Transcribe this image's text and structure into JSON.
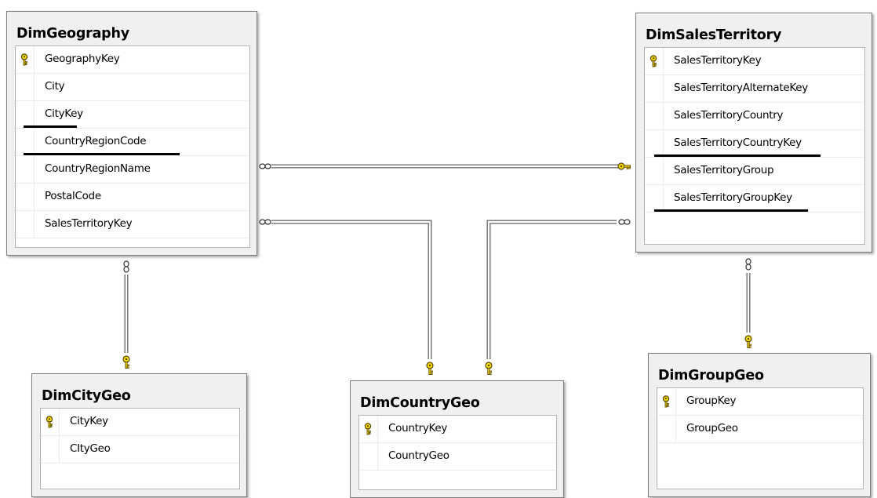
{
  "tables": {
    "dim_geography": {
      "title": "DimGeography",
      "columns": [
        {
          "name": "GeographyKey",
          "primary_key": true
        },
        {
          "name": "City",
          "primary_key": false
        },
        {
          "name": "CityKey",
          "primary_key": false,
          "underlined": true
        },
        {
          "name": "CountryRegionCode",
          "primary_key": false,
          "underlined": true
        },
        {
          "name": "CountryRegionName",
          "primary_key": false
        },
        {
          "name": "PostalCode",
          "primary_key": false
        },
        {
          "name": "SalesTerritoryKey",
          "primary_key": false
        }
      ]
    },
    "dim_sales_territory": {
      "title": "DimSalesTerritory",
      "columns": [
        {
          "name": "SalesTerritoryKey",
          "primary_key": true
        },
        {
          "name": "SalesTerritoryAlternateKey",
          "primary_key": false
        },
        {
          "name": "SalesTerritoryCountry",
          "primary_key": false
        },
        {
          "name": "SalesTerritoryCountryKey",
          "primary_key": false,
          "underlined": true
        },
        {
          "name": "SalesTerritoryGroup",
          "primary_key": false
        },
        {
          "name": "SalesTerritoryGroupKey",
          "primary_key": false,
          "underlined": true
        }
      ]
    },
    "dim_city_geo": {
      "title": "DimCityGeo",
      "columns": [
        {
          "name": "CityKey",
          "primary_key": true
        },
        {
          "name": "CItyGeo",
          "primary_key": false
        }
      ]
    },
    "dim_country_geo": {
      "title": "DimCountryGeo",
      "columns": [
        {
          "name": "CountryKey",
          "primary_key": true
        },
        {
          "name": "CountryGeo",
          "primary_key": false
        }
      ]
    },
    "dim_group_geo": {
      "title": "DimGroupGeo",
      "columns": [
        {
          "name": "GroupKey",
          "primary_key": true
        },
        {
          "name": "GroupGeo",
          "primary_key": false
        }
      ]
    }
  },
  "relationships": [
    {
      "from": "DimGeography",
      "to": "DimSalesTerritory",
      "many_end": "DimGeography",
      "one_end": "DimSalesTerritory"
    },
    {
      "from": "DimGeography",
      "to": "DimCityGeo",
      "many_end": "DimGeography",
      "one_end": "DimCityGeo"
    },
    {
      "from": "DimGeography",
      "to": "DimCountryGeo",
      "many_end": "DimGeography",
      "one_end": "DimCountryGeo"
    },
    {
      "from": "DimSalesTerritory",
      "to": "DimCountryGeo",
      "many_end": "DimSalesTerritory",
      "one_end": "DimCountryGeo"
    },
    {
      "from": "DimSalesTerritory",
      "to": "DimGroupGeo",
      "many_end": "DimSalesTerritory",
      "one_end": "DimGroupGeo"
    }
  ],
  "colors": {
    "key_icon": "#f2d600",
    "connector": "#6f6f6f",
    "table_bg": "#f0f0f0",
    "underline": "#000000"
  }
}
